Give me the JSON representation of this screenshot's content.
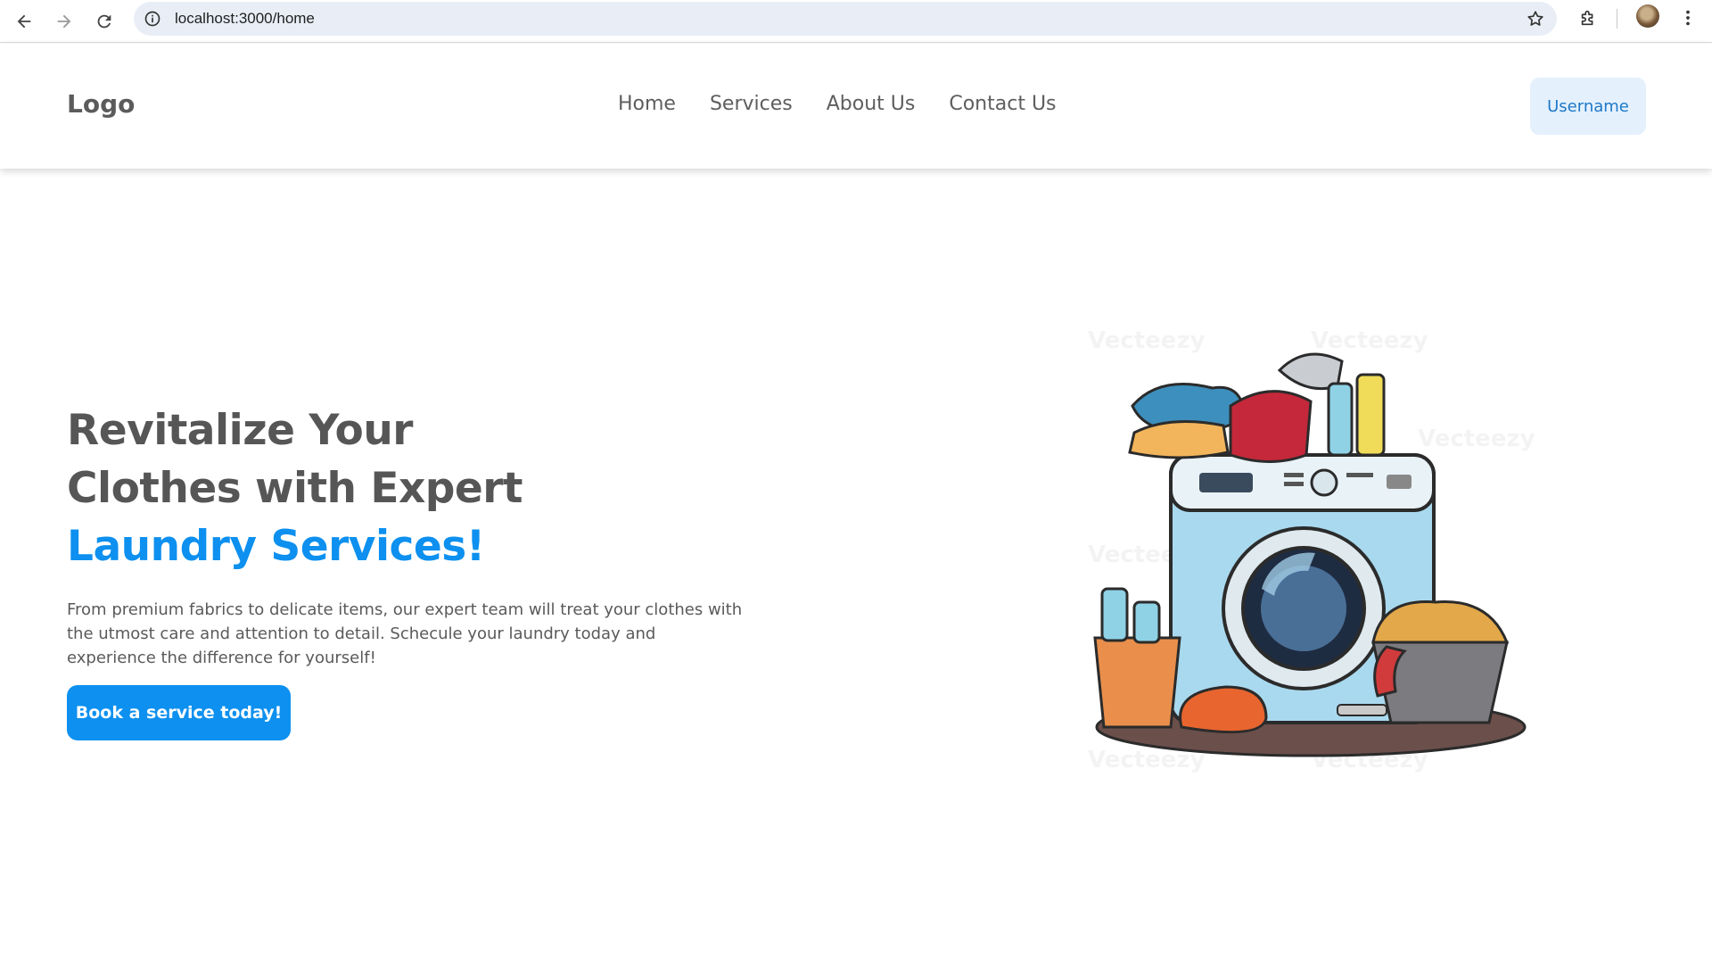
{
  "browser": {
    "url": "localhost:3000/home",
    "icons": [
      "back-arrow-icon",
      "forward-arrow-icon",
      "reload-icon",
      "site-info-icon",
      "bookmark-star-icon",
      "extensions-icon",
      "profile-avatar",
      "more-vert-icon"
    ]
  },
  "header": {
    "logo": "Logo",
    "nav": [
      "Home",
      "Services",
      "About Us",
      "Contact Us"
    ],
    "username": "Username"
  },
  "hero": {
    "heading_line1": "Revitalize Your",
    "heading_line2": "Clothes with Expert",
    "heading_accent": "Laundry Services!",
    "description": "From premium fabrics to delicate items, our expert team will treat your clothes with the utmost care and attention to detail. Schecule your laundry today and experience the difference for yourself!",
    "cta": "Book a service today!"
  },
  "illustration": {
    "subject": "washing-machine-with-laundry-illustration",
    "watermark": "Vecteezy"
  },
  "colors": {
    "accent": "#0d90ef",
    "heading_text": "#565656",
    "username_bg": "#e4f1fd",
    "username_text": "#1e78c8"
  }
}
